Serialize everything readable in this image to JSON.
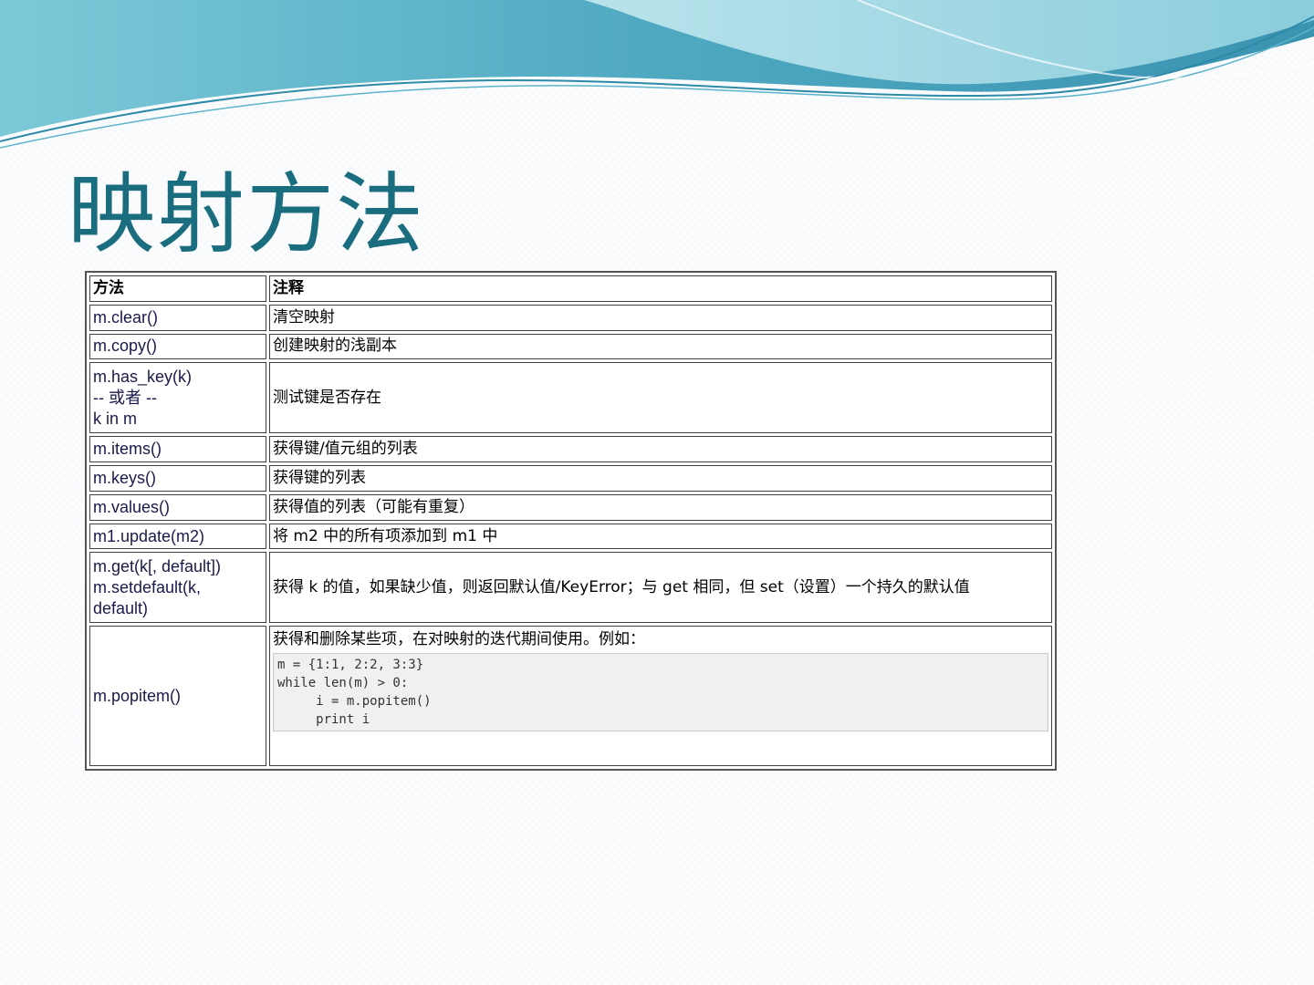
{
  "slide": {
    "title": "映射方法"
  },
  "table": {
    "headers": {
      "method": "方法",
      "note": "注释"
    },
    "rows": [
      {
        "method": [
          "m.clear()"
        ],
        "note": "清空映射"
      },
      {
        "method": [
          "m.copy()"
        ],
        "note": "创建映射的浅副本"
      },
      {
        "method": [
          "m.has_key(k)",
          "-- 或者 --",
          "k in m"
        ],
        "note": "测试键是否存在"
      },
      {
        "method": [
          "m.items()"
        ],
        "note": "获得键/值元组的列表"
      },
      {
        "method": [
          "m.keys()"
        ],
        "note": "获得键的列表"
      },
      {
        "method": [
          "m.values()"
        ],
        "note": "获得值的列表（可能有重复）"
      },
      {
        "method": [
          "m1.update(m2)"
        ],
        "note": "将 m2 中的所有项添加到 m1 中"
      },
      {
        "method": [
          "m.get(k[, default])",
          "m.setdefault(k,",
          "default)"
        ],
        "note": "获得 k 的值，如果缺少值，则返回默认值/KeyError；与 get 相同，但 set（设置）一个持久的默认值"
      },
      {
        "method": [
          "m.popitem()"
        ],
        "note": "获得和删除某些项，在对映射的迭代期间使用。例如："
      }
    ],
    "code_example": [
      "m = {1:1, 2:2, 3:3}",
      "while len(m) > 0:",
      "     i = m.popitem()",
      "     print i"
    ]
  },
  "colors": {
    "title": "#1a6d7f",
    "wave_light": "#a8dde6",
    "wave_mid": "#5fb6cb",
    "wave_dark": "#2f8fab",
    "background": "#fbfcfd"
  }
}
